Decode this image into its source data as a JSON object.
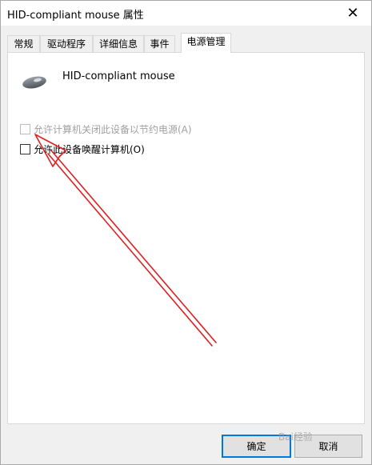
{
  "window": {
    "title": "HID-compliant mouse 属性",
    "close_glyph": "✕"
  },
  "tabs": [
    {
      "label": "常规"
    },
    {
      "label": "驱动程序"
    },
    {
      "label": "详细信息"
    },
    {
      "label": "事件"
    },
    {
      "label": "电源管理",
      "active": true
    }
  ],
  "device": {
    "name": "HID-compliant mouse",
    "icon": "mouse-icon"
  },
  "options": [
    {
      "label": "允许计算机关闭此设备以节约电源(A)",
      "checked": false,
      "enabled": false
    },
    {
      "label": "允许此设备唤醒计算机(O)",
      "checked": false,
      "enabled": true
    }
  ],
  "buttons": {
    "ok": "确定",
    "cancel": "取消"
  },
  "annotation": {
    "arrow_color": "#e02020"
  },
  "watermark": "Bai经验"
}
